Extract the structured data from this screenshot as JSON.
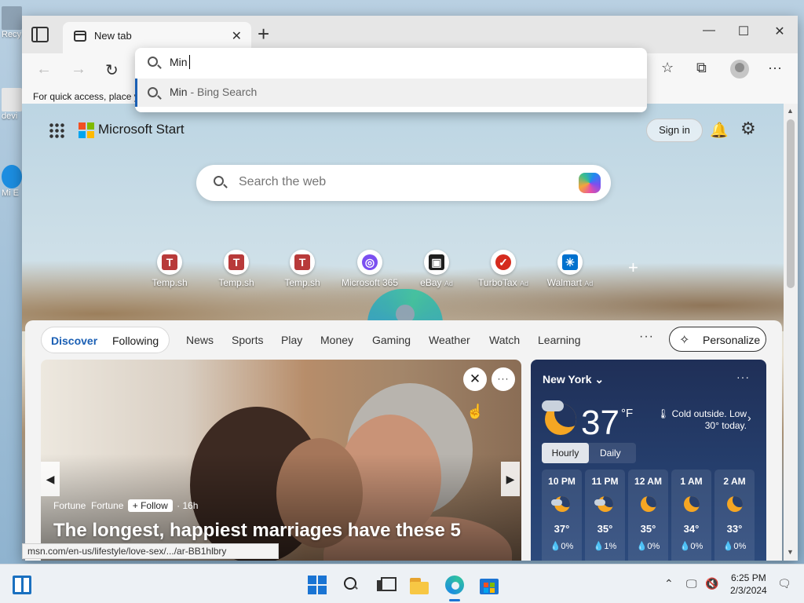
{
  "desktop": {
    "icons": [
      {
        "label": "Recy",
        "color": "#8da1b3"
      },
      {
        "label": "devi",
        "color": "#e6e6e6"
      },
      {
        "label": "Mi E",
        "color": "#1c8de0"
      }
    ]
  },
  "browser": {
    "tab": {
      "title": "New tab",
      "close_glyph": "✕"
    },
    "new_tab_glyph": "+",
    "window_controls": {
      "minimize": "—",
      "maximize": "☐",
      "close": "✕"
    },
    "nav": {
      "back": "←",
      "forward": "→",
      "refresh": "↻"
    },
    "toolbar_icons": {
      "favorites": "☆",
      "collections": "⧉",
      "menu": "···"
    },
    "favorites_bar_text": "For quick access, place y",
    "address": {
      "typed_value": "Min",
      "suggestion_term": "Min",
      "suggestion_suffix": " - Bing Search"
    },
    "status_url": "msn.com/en-us/lifestyle/love-sex/.../ar-BB1hlbry"
  },
  "ntp": {
    "brand": "Microsoft Start",
    "signin_label": "Sign in",
    "bell_glyph": "🔔",
    "gear_glyph": "⚙",
    "search_placeholder": "Search the web",
    "tiles": [
      {
        "label": "Temp.sh",
        "glyph": "T",
        "color": "#b83a3a",
        "ad": ""
      },
      {
        "label": "Temp.sh",
        "glyph": "T",
        "color": "#b83a3a",
        "ad": ""
      },
      {
        "label": "Temp.sh",
        "glyph": "T",
        "color": "#b83a3a",
        "ad": ""
      },
      {
        "label": "Microsoft 365",
        "glyph": "◎",
        "color": "#7b4ff0",
        "ad": ""
      },
      {
        "label": "eBay",
        "glyph": "▣",
        "color": "#1f1f1f",
        "ad": "Ad"
      },
      {
        "label": "TurboTax",
        "glyph": "✓",
        "color": "#d52b1e",
        "ad": "Ad"
      },
      {
        "label": "Walmart",
        "glyph": "✳",
        "color": "#0071ce",
        "ad": "Ad"
      }
    ],
    "add_tile_glyph": "+",
    "feed": {
      "pills": [
        "Discover",
        "Following"
      ],
      "tabs": [
        "News",
        "Sports",
        "Play",
        "Money",
        "Gaming",
        "Weather",
        "Watch",
        "Learning"
      ],
      "more_glyph": "···",
      "personalize_label": "Personalize",
      "personalize_glyph": "✧",
      "story": {
        "source_logo_text": "Fortune",
        "source_name": "Fortune",
        "follow_label": "+ Follow",
        "age": "· 16h",
        "headline": "The longest, happiest marriages have these 5",
        "close_glyph": "✕",
        "more_glyph": "···",
        "prev_glyph": "◀",
        "next_glyph": "▶"
      },
      "weather": {
        "city": "New York",
        "chevron": "⌄",
        "more_glyph": "···",
        "temp": "37",
        "unit": "°F",
        "description": "🌡 Cold outside. Low 30° today.",
        "arrow": "›",
        "tabs": [
          "Hourly",
          "Daily"
        ],
        "hours": [
          {
            "time": "10 PM",
            "temp": "37°",
            "precip": "💧0%",
            "cloud": true
          },
          {
            "time": "11 PM",
            "temp": "35°",
            "precip": "💧1%",
            "cloud": true
          },
          {
            "time": "12 AM",
            "temp": "35°",
            "precip": "💧0%",
            "cloud": false
          },
          {
            "time": "1 AM",
            "temp": "34°",
            "precip": "💧0%",
            "cloud": false
          },
          {
            "time": "2 AM",
            "temp": "33°",
            "precip": "💧0%",
            "cloud": false
          }
        ]
      }
    }
  },
  "taskbar": {
    "tray_chevron": "⌃",
    "tray_icons": [
      "🖵",
      "🔇"
    ],
    "notification_glyph": "🗨",
    "time": "6:25 PM",
    "date": "2/3/2024"
  },
  "colors": {
    "accent": "#1a5fb4",
    "weather_bg": "#1f2f57"
  }
}
